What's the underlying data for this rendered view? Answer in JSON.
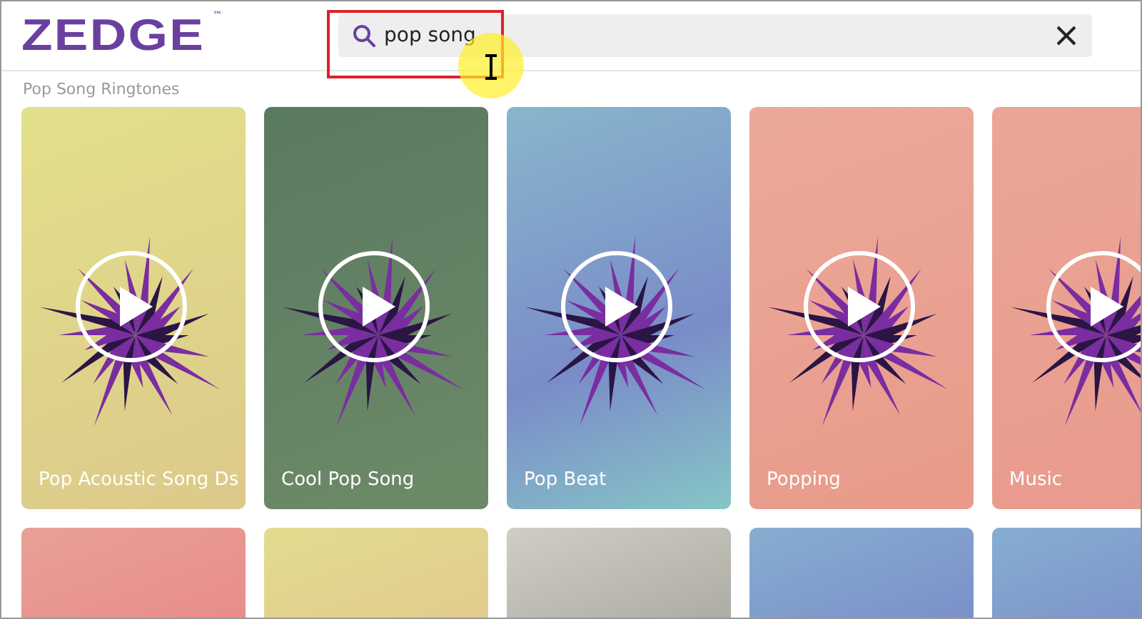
{
  "header": {
    "logo": "ZEDGE",
    "logo_mark": "™",
    "search": {
      "value": "pop song"
    }
  },
  "section_title": "Pop Song Ringtones",
  "ringtones": [
    {
      "title": "Pop Acoustic Song Ds"
    },
    {
      "title": "Cool Pop Song"
    },
    {
      "title": "Pop Beat"
    },
    {
      "title": "Popping"
    },
    {
      "title": "Music"
    }
  ]
}
